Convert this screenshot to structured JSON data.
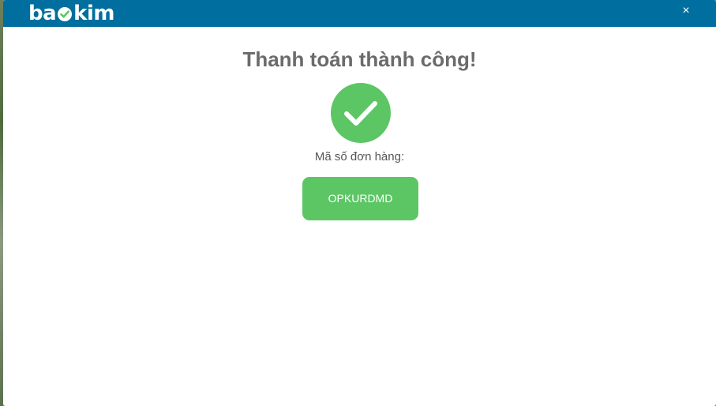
{
  "header": {
    "logo_text_left": "ba",
    "logo_text_right": "kim",
    "close_symbol": "×",
    "background_color": "#006e9e"
  },
  "main": {
    "title": "Thanh toán thành công!",
    "success_icon": "check-icon",
    "order_label": "Mã số đơn hàng:",
    "order_code": "OPKURDMD",
    "accent_color": "#5cc665"
  }
}
